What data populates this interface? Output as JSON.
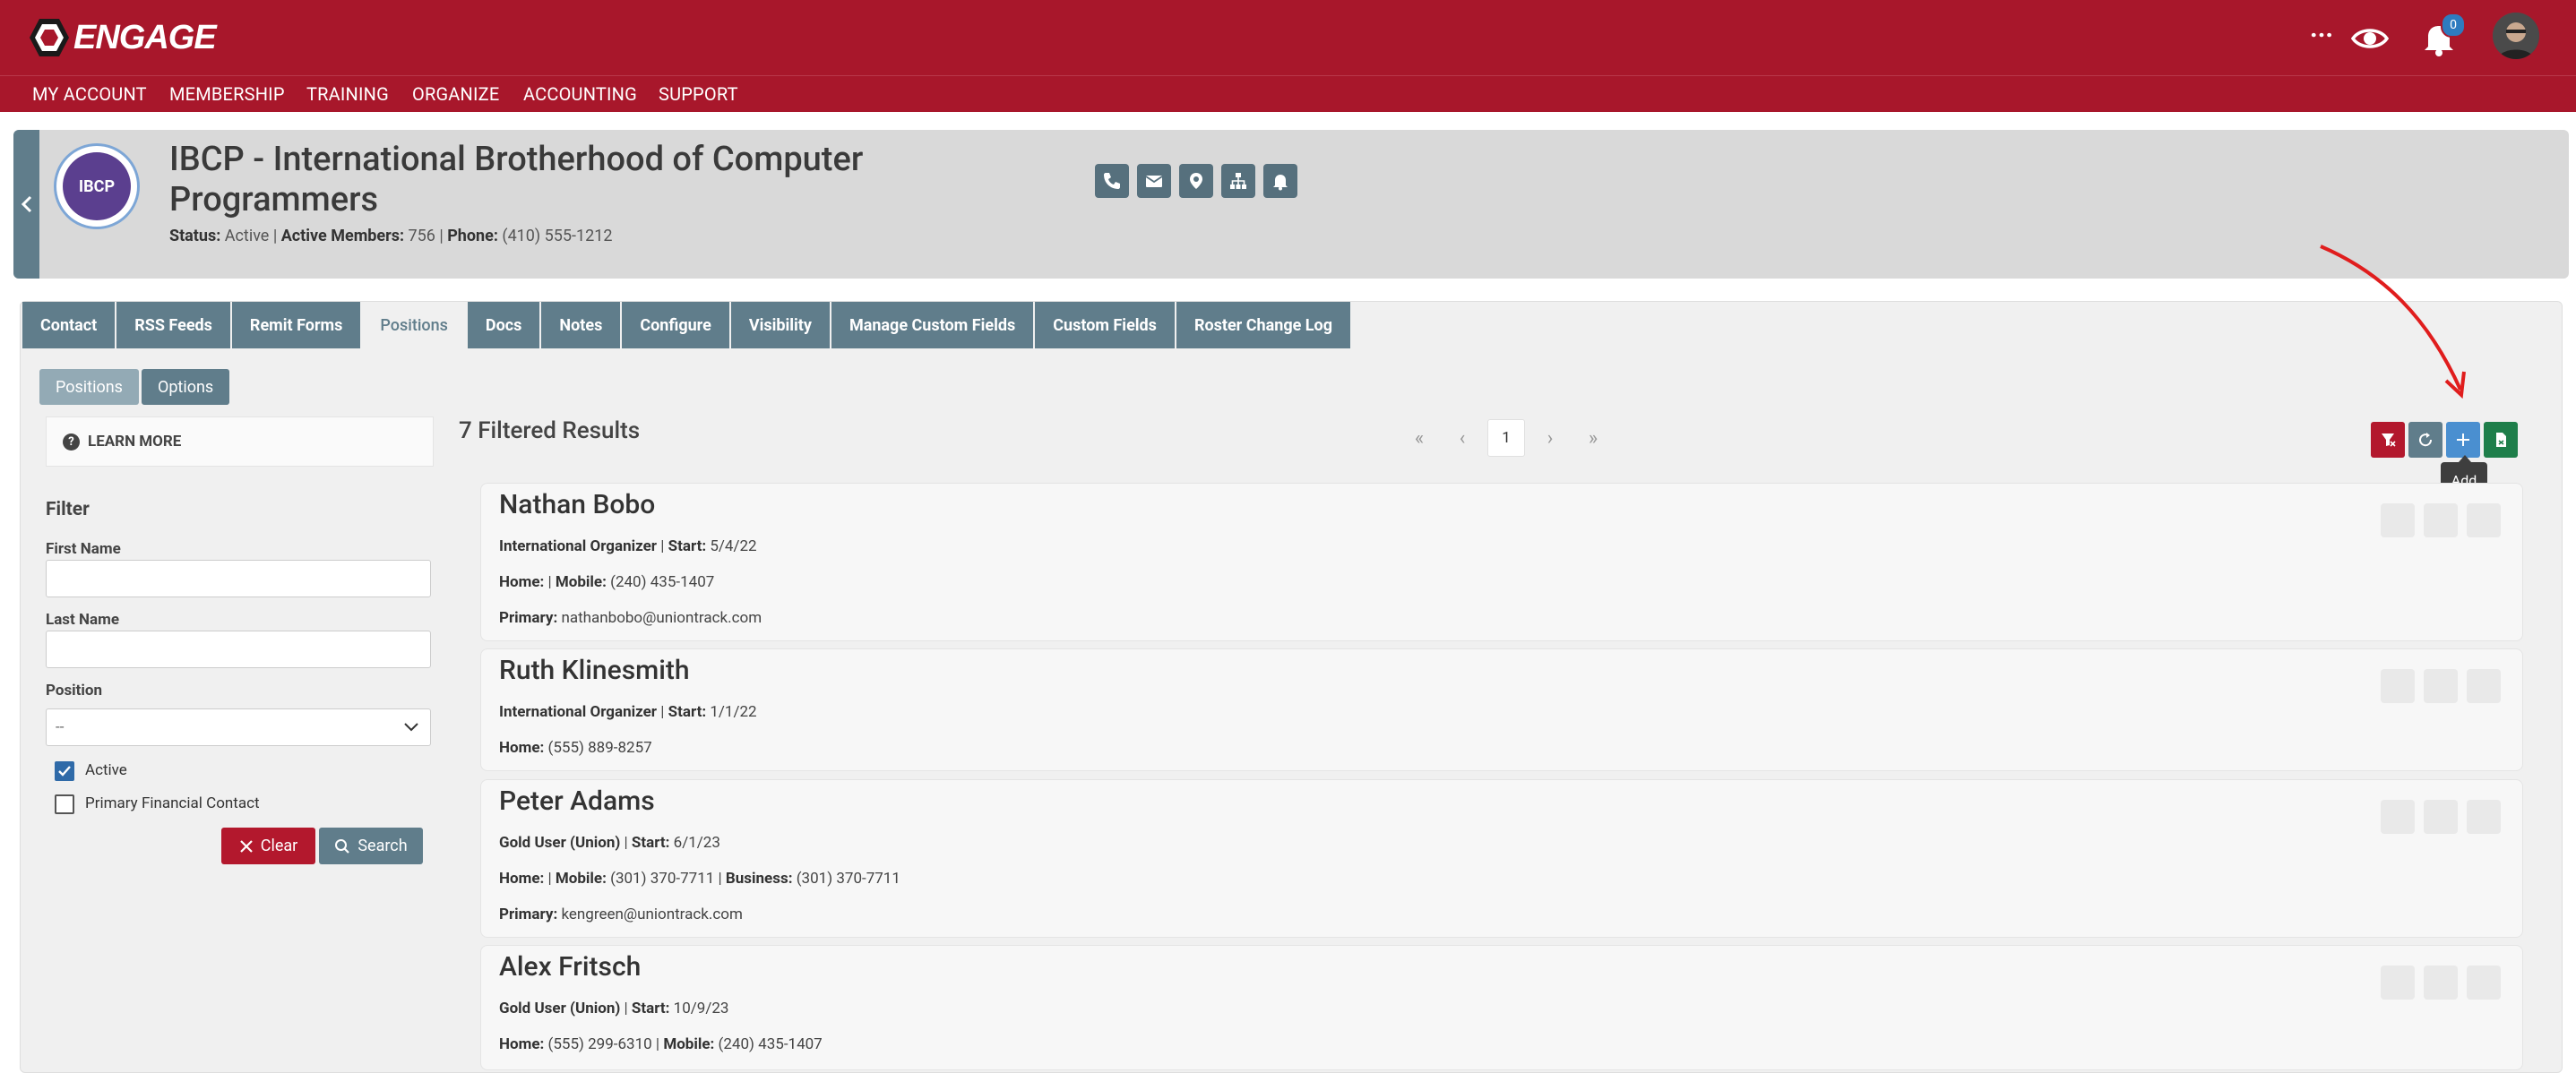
{
  "app": {
    "name": "ENGAGE"
  },
  "topbar": {
    "more_label": "...",
    "notification_count": "0"
  },
  "nav": {
    "items": [
      "MY ACCOUNT",
      "MEMBERSHIP",
      "TRAINING",
      "ORGANIZE",
      "ACCOUNTING",
      "SUPPORT"
    ]
  },
  "org": {
    "logo_text": "IBCP",
    "title": "IBCP - International Brotherhood of Computer Programmers",
    "status_label": "Status:",
    "status_value": "Active",
    "members_label": "Active Members:",
    "members_value": "756",
    "phone_label": "Phone:",
    "phone_value": "(410) 555-1212",
    "actions": [
      "phone-icon",
      "envelope-icon",
      "map-pin-icon",
      "org-chart-icon",
      "bell-icon"
    ]
  },
  "tabs": [
    "Contact",
    "RSS Feeds",
    "Remit Forms",
    "Positions",
    "Docs",
    "Notes",
    "Configure",
    "Visibility",
    "Manage Custom Fields",
    "Custom Fields",
    "Roster Change Log"
  ],
  "active_tab": "Positions",
  "subtabs": [
    "Positions",
    "Options"
  ],
  "sidebar": {
    "learn_more": "LEARN MORE",
    "filter_title": "Filter",
    "first_name_label": "First Name",
    "first_name_value": "",
    "last_name_label": "Last Name",
    "last_name_value": "",
    "position_label": "Position",
    "position_value": "--",
    "active_label": "Active",
    "active_checked": true,
    "primary_financial_label": "Primary Financial Contact",
    "primary_financial_checked": false,
    "clear_label": "Clear",
    "search_label": "Search"
  },
  "results": {
    "summary": "7 Filtered Results",
    "current_page": "1",
    "tooltip": "Add",
    "tool_colors": {
      "filter": "#b3182d",
      "refresh": "#607d8b",
      "add": "#4a8fd0",
      "export": "#1e7e4a"
    }
  },
  "records": [
    {
      "name": "Nathan Bobo",
      "role": "International Organizer",
      "start_label": "Start:",
      "start": "5/4/22",
      "home_label": "Home:",
      "home": "",
      "mobile_label": "Mobile:",
      "mobile": "(240) 435-1407",
      "primary_label": "Primary:",
      "primary": "nathanbobo@uniontrack.com"
    },
    {
      "name": "Ruth Klinesmith",
      "role": "International Organizer",
      "start_label": "Start:",
      "start": "1/1/22",
      "home_label": "Home:",
      "home": "(555) 889-8257"
    },
    {
      "name": "Peter Adams",
      "role": "Gold User (Union)",
      "start_label": "Start:",
      "start": "6/1/23",
      "home_label": "Home:",
      "home": "",
      "mobile_label": "Mobile:",
      "mobile": "(301) 370-7711",
      "business_label": "Business:",
      "business": "(301) 370-7711",
      "primary_label": "Primary:",
      "primary": "kengreen@uniontrack.com"
    },
    {
      "name": "Alex Fritsch",
      "role": "Gold User (Union)",
      "start_label": "Start:",
      "start": "10/9/23",
      "home_label": "Home:",
      "home": "(555) 299-6310",
      "mobile_label": "Mobile:",
      "mobile": "(240) 435-1407"
    }
  ]
}
